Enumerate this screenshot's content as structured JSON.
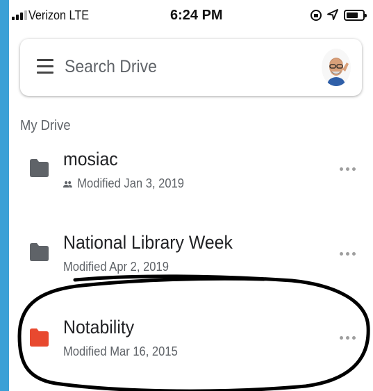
{
  "status_bar": {
    "carrier": "Verizon  LTE",
    "time": "6:24 PM"
  },
  "search": {
    "label": "Search Drive",
    "menu_icon": "hamburger-menu-icon",
    "avatar_icon": "user-avatar"
  },
  "section_title": "My Drive",
  "files": [
    {
      "name": "mosiac",
      "modified": "Modified Jan 3, 2019",
      "shared": true,
      "folder_color": "#5f6368"
    },
    {
      "name": "National Library Week",
      "modified": "Modified Apr 2, 2019",
      "shared": false,
      "folder_color": "#5f6368"
    },
    {
      "name": "Notability",
      "modified": "Modified Mar 16, 2015",
      "shared": false,
      "folder_color": "#e8492f"
    }
  ],
  "colors": {
    "frame": "#3aa0d6",
    "annotation": "#000000"
  }
}
